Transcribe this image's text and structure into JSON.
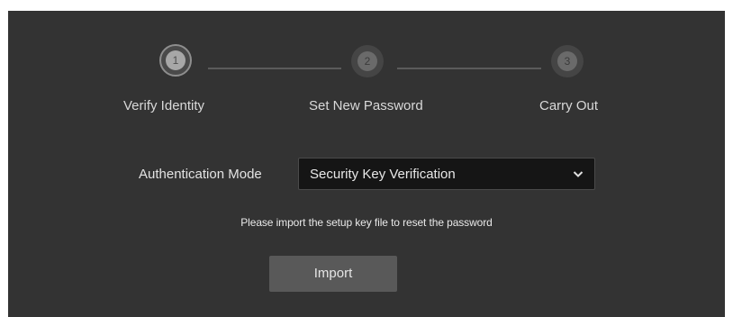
{
  "stepper": {
    "steps": [
      {
        "number": "1",
        "label": "Verify Identity",
        "active": true
      },
      {
        "number": "2",
        "label": "Set New Password",
        "active": false
      },
      {
        "number": "3",
        "label": "Carry Out",
        "active": false
      }
    ]
  },
  "form": {
    "auth_mode_label": "Authentication Mode",
    "auth_mode_value": "Security Key Verification",
    "hint": "Please import the setup key file to reset the password",
    "import_label": "Import"
  },
  "colors": {
    "panel_bg": "#333333",
    "select_bg": "#151515",
    "button_bg": "#595959"
  }
}
